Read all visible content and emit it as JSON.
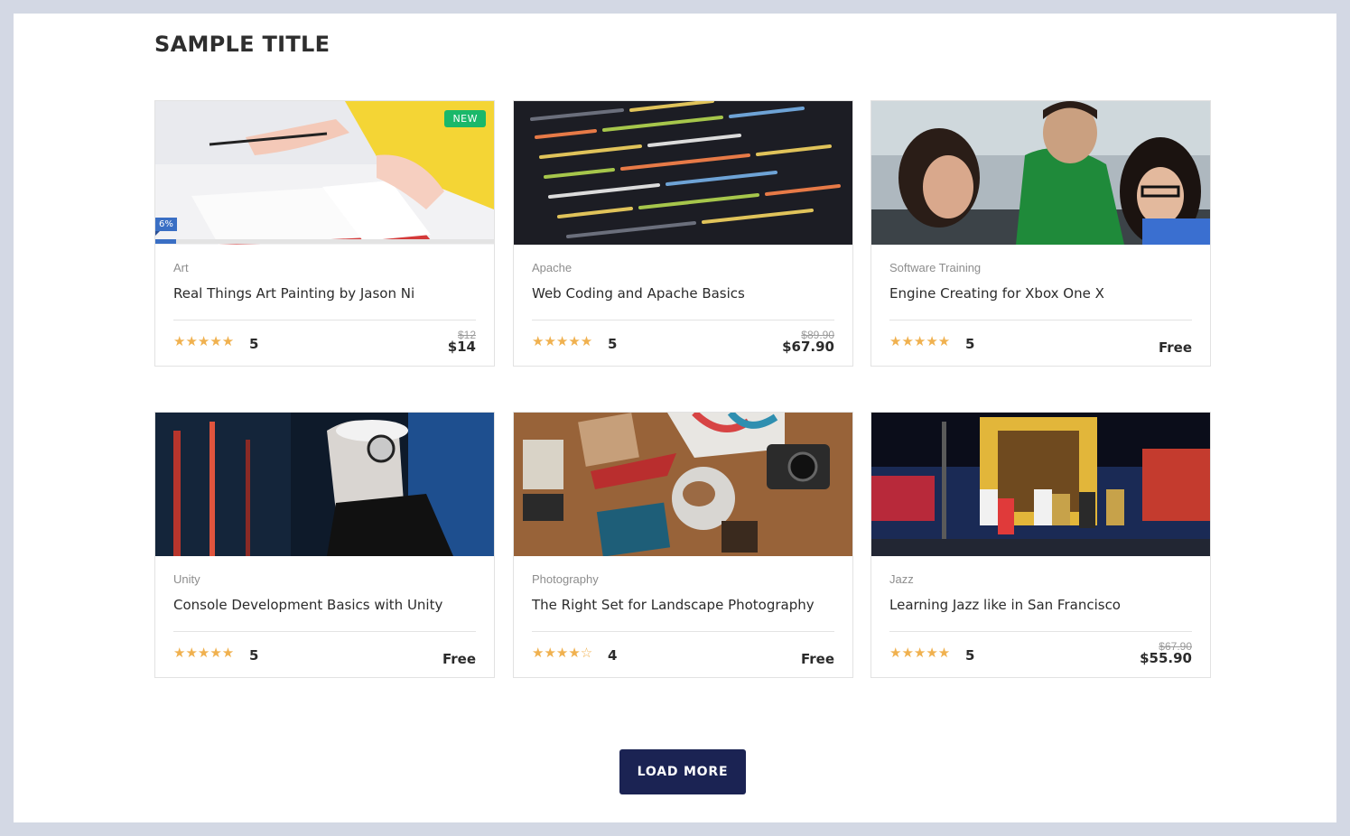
{
  "page": {
    "title": "SAMPLE TITLE"
  },
  "colors": {
    "accent": "#1b2353",
    "star": "#f0b14f",
    "badge_new": "#1ab86a",
    "progress": "#3a6fc4"
  },
  "courses": [
    {
      "category": "Art",
      "title": "Real Things Art Painting by Jason Ni",
      "stars": "★★★★★",
      "rating": "5",
      "price_old": "$12",
      "price": "$14",
      "badge": "NEW",
      "progress_label": "6%",
      "progress": 0.06,
      "image": "hand-drawing-notebook"
    },
    {
      "category": "Apache",
      "title": "Web Coding and Apache Basics",
      "stars": "★★★★★",
      "rating": "5",
      "price_old": "$89.90",
      "price": "$67.90",
      "image": "code-on-screen"
    },
    {
      "category": "Software Training",
      "title": "Engine Creating for Xbox One X",
      "stars": "★★★★★",
      "rating": "5",
      "price": "Free",
      "image": "people-at-computer"
    },
    {
      "category": "Unity",
      "title": "Console Development Basics with Unity",
      "stars": "★★★★★",
      "rating": "5",
      "price": "Free",
      "image": "dj-headphones"
    },
    {
      "category": "Photography",
      "title": "The Right Set for Landscape Photography",
      "stars": "★★★★☆",
      "rating": "4",
      "price": "Free",
      "image": "flatlay-desk"
    },
    {
      "category": "Jazz",
      "title": "Learning Jazz like in San Francisco",
      "stars": "★★★★★",
      "rating": "5",
      "price_old": "$67.90",
      "price": "$55.90",
      "image": "street-band"
    }
  ],
  "load_more": {
    "label": "LOAD MORE"
  }
}
